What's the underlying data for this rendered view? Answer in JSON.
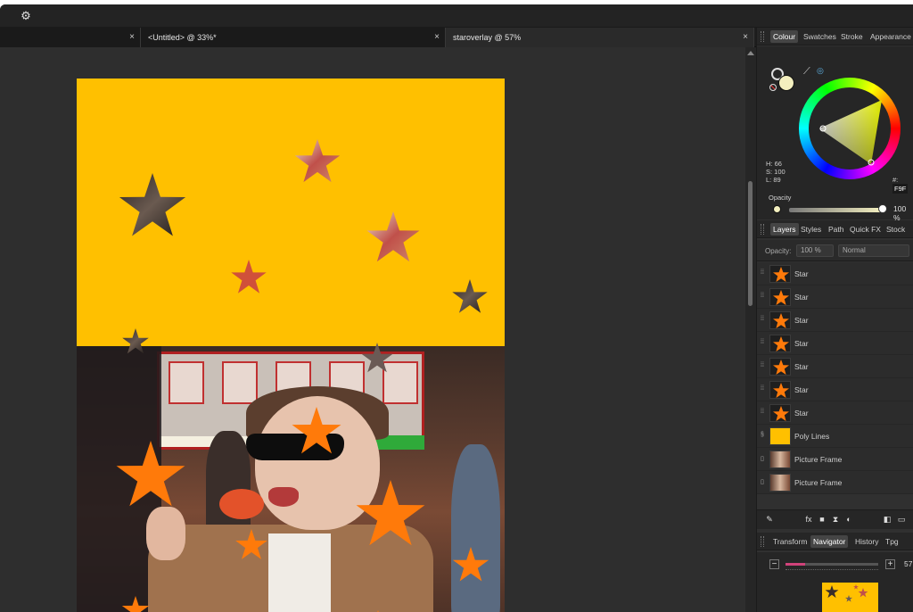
{
  "toolbar": {
    "settings_icon": "gear-icon"
  },
  "tabs": [
    {
      "label": "",
      "close": "×"
    },
    {
      "label": "<Untitled> @ 33%*",
      "close": "×"
    },
    {
      "label": "staroverlay @ 57%",
      "close": "×"
    }
  ],
  "colour_panel": {
    "tabs": [
      "Colour",
      "Swatches",
      "Stroke",
      "Appearance"
    ],
    "active_tab": "Colour",
    "h": "H: 66",
    "s": "S: 100",
    "l": "L: 89",
    "hex_label": "#:",
    "hex_value": "F9F",
    "opacity_label": "Opacity",
    "opacity_value": "100 %",
    "primary_color": "#f3efbf"
  },
  "layers_panel": {
    "tabs": [
      "Layers",
      "Styles",
      "Path",
      "Quick FX",
      "Stock"
    ],
    "active_tab": "Layers",
    "opacity_label": "Opacity:",
    "opacity_value": "100 %",
    "blend_mode": "Normal",
    "layers": [
      {
        "name": "Star",
        "kind": "star"
      },
      {
        "name": "Star",
        "kind": "star"
      },
      {
        "name": "Star",
        "kind": "star"
      },
      {
        "name": "Star",
        "kind": "star"
      },
      {
        "name": "Star",
        "kind": "star"
      },
      {
        "name": "Star",
        "kind": "star"
      },
      {
        "name": "Star",
        "kind": "star"
      },
      {
        "name": "Poly Lines",
        "kind": "poly"
      },
      {
        "name": "Picture Frame",
        "kind": "photo"
      },
      {
        "name": "Picture Frame",
        "kind": "photo"
      }
    ]
  },
  "nav_panel": {
    "tabs": [
      "Transform",
      "Navigator",
      "History",
      "Tpg"
    ],
    "active_tab": "Navigator",
    "minus": "−",
    "plus": "+",
    "zoom_value": "57"
  },
  "colors": {
    "accent_orange": "#ff7a0a",
    "background_yellow": "#ffc000"
  }
}
